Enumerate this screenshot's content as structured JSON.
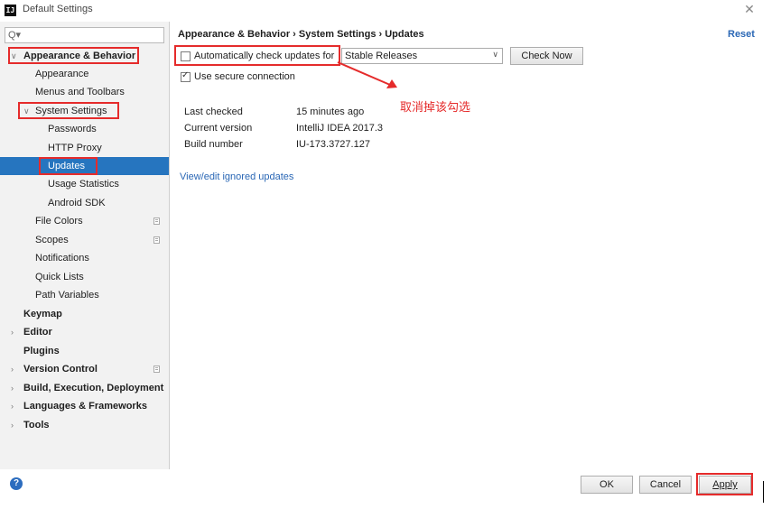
{
  "window": {
    "title": "Default Settings",
    "app_icon": "intellij-app-icon",
    "close_glyph": "✕"
  },
  "search": {
    "glyph": "Q▾",
    "placeholder": ""
  },
  "tree": {
    "items": [
      {
        "label": "Appearance & Behavior",
        "expanded": true
      },
      {
        "label": "Appearance"
      },
      {
        "label": "Menus and Toolbars"
      },
      {
        "label": "System Settings",
        "expanded": true
      },
      {
        "label": "Passwords"
      },
      {
        "label": "HTTP Proxy"
      },
      {
        "label": "Updates",
        "selected": true
      },
      {
        "label": "Usage Statistics"
      },
      {
        "label": "Android SDK"
      },
      {
        "label": "File Colors"
      },
      {
        "label": "Scopes"
      },
      {
        "label": "Notifications"
      },
      {
        "label": "Quick Lists"
      },
      {
        "label": "Path Variables"
      },
      {
        "label": "Keymap"
      },
      {
        "label": "Editor"
      },
      {
        "label": "Plugins"
      },
      {
        "label": "Version Control"
      },
      {
        "label": "Build, Execution, Deployment"
      },
      {
        "label": "Languages & Frameworks"
      },
      {
        "label": "Tools"
      }
    ]
  },
  "main": {
    "breadcrumb": "Appearance & Behavior › System Settings › Updates",
    "reset_label": "Reset",
    "auto_check_label": "Automatically check updates for",
    "auto_check_checked": false,
    "channel_selected": "Stable Releases",
    "check_now_label": "Check Now",
    "secure_label": "Use secure connection",
    "secure_checked": true,
    "info": {
      "last_checked_label": "Last checked",
      "last_checked_value": "15 minutes ago",
      "current_version_label": "Current version",
      "current_version_value": "IntelliJ IDEA 2017.3",
      "build_number_label": "Build number",
      "build_number_value": "IU-173.3727.127"
    },
    "ignored_link": "View/edit ignored updates"
  },
  "annotation": {
    "text": "取消掉该勾选",
    "color": "#e52b2b"
  },
  "footer": {
    "help_glyph": "?",
    "ok_label": "OK",
    "cancel_label": "Cancel",
    "apply_label": "Apply"
  },
  "colors": {
    "accent": "#2675bf",
    "link": "#2a67b5",
    "annotation_red": "#e52b2b"
  }
}
